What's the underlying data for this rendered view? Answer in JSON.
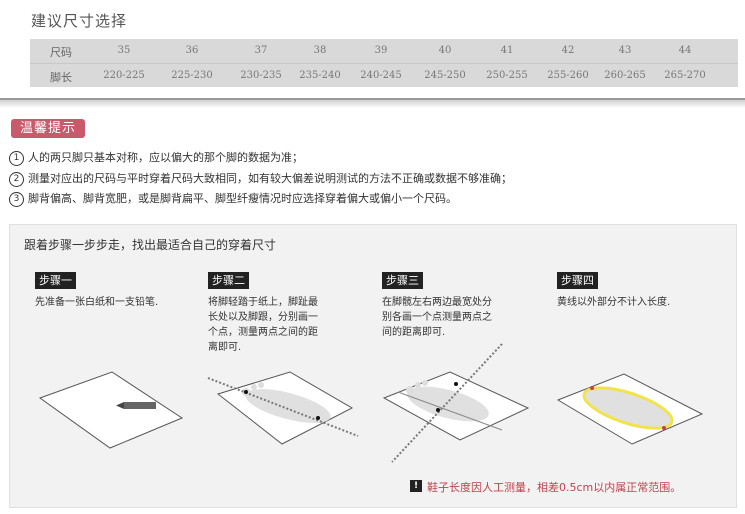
{
  "size_chart": {
    "title": "建议尺寸选择",
    "row_labels": [
      "尺码",
      "脚长"
    ],
    "sizes": [
      "35",
      "36",
      "37",
      "38",
      "39",
      "40",
      "41",
      "42",
      "43",
      "44"
    ],
    "lengths": [
      "220-225",
      "225-230",
      "230-235",
      "235-240",
      "240-245",
      "245-250",
      "250-255",
      "255-260",
      "260-265",
      "265-270"
    ]
  },
  "tips": {
    "badge": "温馨提示",
    "items": [
      {
        "num": "1",
        "text": "人的两只脚只基本对称，应以偏大的那个脚的数据为准；"
      },
      {
        "num": "2",
        "text": "测量对应出的尺码与平时穿着尺码大致相同，如有较大偏差说明测试的方法不正确或数据不够准确；"
      },
      {
        "num": "3",
        "text": "脚背偏高、脚背宽肥，或是脚背扁平、脚型纤瘦情况时应选择穿着偏大或偏小一个尺码。"
      }
    ]
  },
  "steps": {
    "title": "跟着步骤一步步走，找出最适合自己的穿着尺寸",
    "items": [
      {
        "badge": "步骤一",
        "lines": [
          "先准备一张白纸和一支铅笔."
        ]
      },
      {
        "badge": "步骤二",
        "lines": [
          "将脚轻踏于纸上，脚趾最",
          "长处以及脚跟，分别画一",
          "个点，测量两点之间的距",
          "离即可."
        ]
      },
      {
        "badge": "步骤三",
        "lines": [
          "在脚髋左右两边最宽处分",
          "别各画一个点测量两点之",
          "间的距离即可."
        ]
      },
      {
        "badge": "步骤四",
        "lines": [
          "黄线以外部分不计入长度."
        ]
      }
    ],
    "note": "鞋子长度因人工测量，相差0.5cm以内属正常范围。",
    "note_icon": "!"
  },
  "colors": {
    "badge_pink": "#c85a6c",
    "note_red": "#c0434f",
    "step_badge": "#222222",
    "highlight_yellow": "#f2e34a"
  }
}
